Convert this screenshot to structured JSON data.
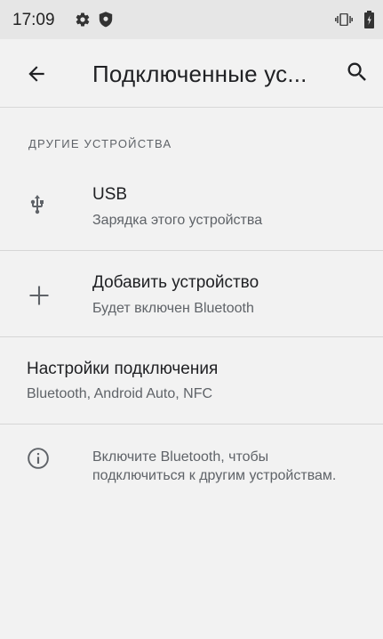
{
  "status_bar": {
    "time": "17:09",
    "icons": [
      "gear-icon",
      "shield-icon",
      "vibrate-icon",
      "battery-icon"
    ]
  },
  "app_bar": {
    "title": "Подключенные ус...",
    "back_icon": "arrow-left-icon",
    "search_icon": "search-icon"
  },
  "section": {
    "header": "ДРУГИЕ УСТРОЙСТВА"
  },
  "items": [
    {
      "title": "USB",
      "subtitle": "Зарядка этого устройства",
      "icon": "usb-icon"
    },
    {
      "title": "Добавить устройство",
      "subtitle": "Будет включен Bluetooth",
      "icon": "plus-icon"
    },
    {
      "title": "Настройки подключения",
      "subtitle": "Bluetooth, Android Auto, NFC",
      "icon": ""
    }
  ],
  "info": {
    "icon": "info-icon",
    "text": "Включите Bluetooth, чтобы подключиться к другим устройствам."
  },
  "colors": {
    "background": "#f2f2f2",
    "status_bar": "#e6e6e6",
    "primary_text": "#202124",
    "secondary_text": "#5f6368",
    "divider": "#d6d6d6"
  }
}
